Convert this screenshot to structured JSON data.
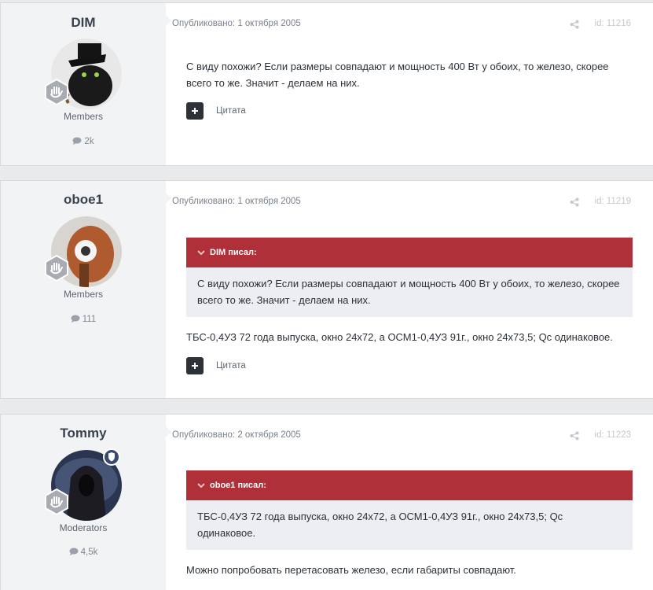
{
  "posts": [
    {
      "author": "DIM",
      "group": "Members",
      "post_count": "2k",
      "published": "Опубликовано: 1 октября 2005",
      "id": "id: 11216",
      "quote": null,
      "text": "С виду похожи? Если размеры совпадают и мощность 400 Вт у обоих, то железо, скорее всего то же. Значит - делаем на них.",
      "quote_button": "Цитата"
    },
    {
      "author": "oboe1",
      "group": "Members",
      "post_count": "111",
      "published": "Опубликовано: 1 октября 2005",
      "id": "id: 11219",
      "quote": {
        "header": "DIM писал:",
        "text": "С виду похожи? Если размеры совпадают и мощность 400 Вт у обоих, то железо, скорее всего то же. Значит - делаем на них."
      },
      "text": "ТБС-0,4УЗ 72 года выпуска, окно 24х72, а ОСМ1-0,4УЗ 91г., окно 24х73,5; Qc одинаковое.",
      "quote_button": "Цитата"
    },
    {
      "author": "Tommy",
      "group": "Moderators",
      "post_count": "4,5k",
      "published": "Опубликовано: 2 октября 2005",
      "id": "id: 11223",
      "quote": {
        "header": "oboe1 писал:",
        "text": "ТБС-0,4УЗ 72 года выпуска, окно 24х72, а ОСМ1-0,4УЗ 91г., окно 24х73,5; Qc одинаковое."
      },
      "text": "Можно попробовать перетасовать железо, если габариты совпадают.",
      "quote_button": ""
    }
  ],
  "colors": {
    "quote_header": "#b0303a",
    "author_bg": "#f2f3f5",
    "page_bg": "#e9eaec"
  },
  "icons": {
    "rank_badge": "hand-badge-icon",
    "moderator_badge": "shield-icon",
    "post_count": "comment-icon",
    "share": "share-icon",
    "quote_header": "chevron-down-icon",
    "quote_button": "plus-icon"
  }
}
